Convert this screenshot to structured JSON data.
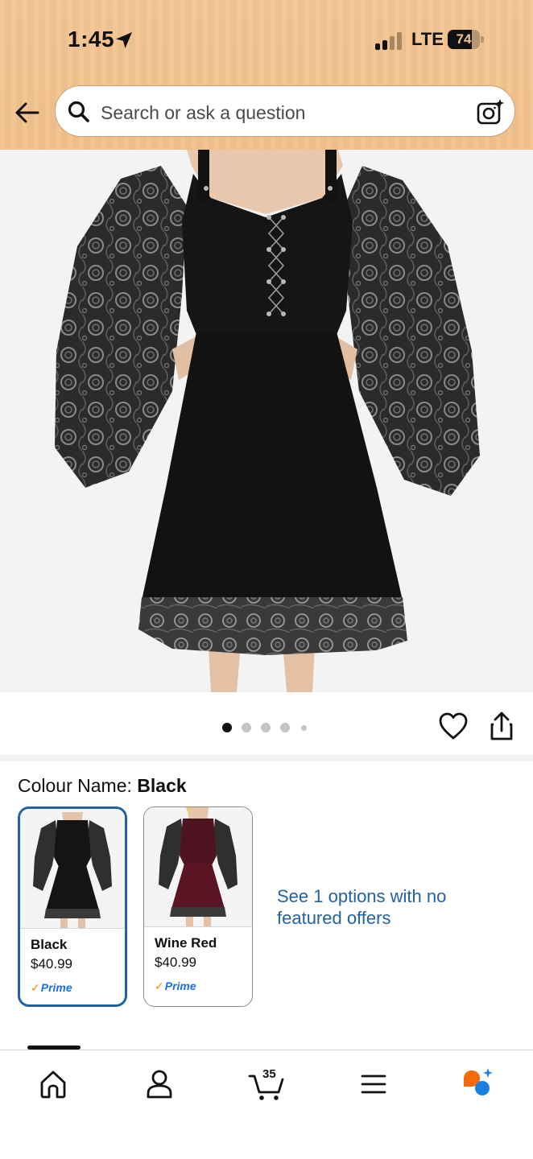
{
  "status_bar": {
    "time": "1:45",
    "network": "LTE",
    "battery": "74"
  },
  "search": {
    "placeholder": "Search or ask a question"
  },
  "icons": {
    "back": "back-arrow-icon",
    "search": "search-icon",
    "camera": "camera-lens-icon",
    "wishlist": "heart-icon",
    "share": "share-icon",
    "home": "home-icon",
    "account": "person-icon",
    "cart": "cart-icon",
    "menu": "hamburger-menu-icon",
    "rufus": "rufus-chat-icon"
  },
  "gallery": {
    "dot_count": 5,
    "active_index": 0
  },
  "colour": {
    "label": "Colour Name: ",
    "selected": "Black",
    "options": [
      {
        "name": "Black",
        "price": "$40.99",
        "prime": "Prime",
        "color": "#111111"
      },
      {
        "name": "Wine Red",
        "price": "$40.99",
        "prime": "Prime",
        "color": "#5a1424"
      }
    ],
    "see_offers": "See 1 options with no featured offers"
  },
  "nav": {
    "cart_count": "35"
  },
  "colors": {
    "header": "#f2c08b",
    "link": "#2162a1",
    "prime_check": "#f08804",
    "prime_text": "#1b6ee0"
  }
}
